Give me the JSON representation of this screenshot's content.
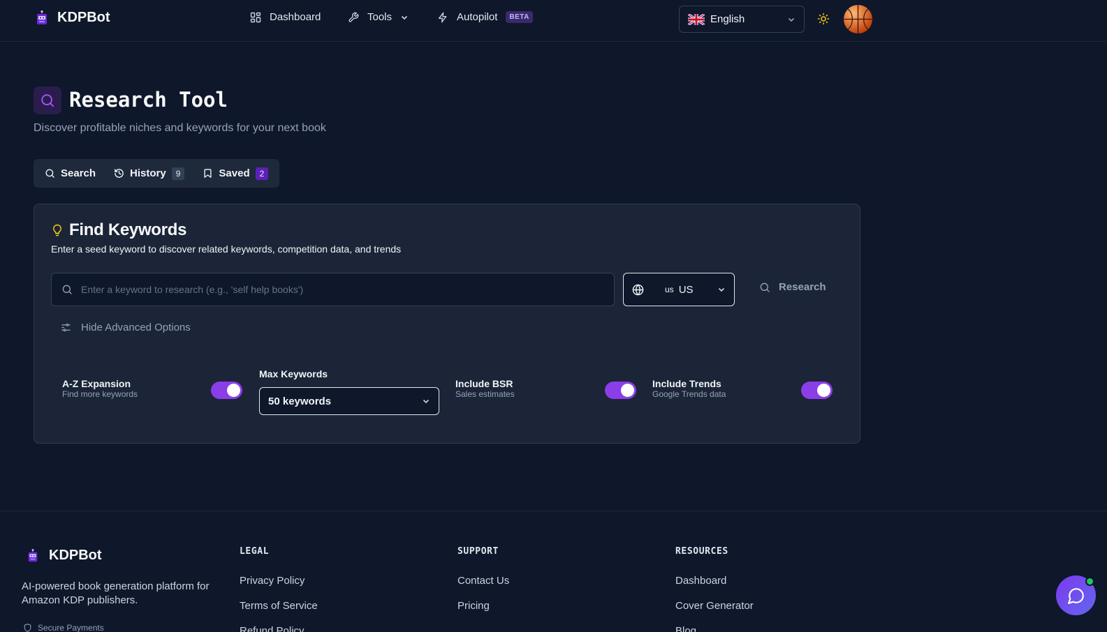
{
  "header": {
    "brand": "KDPBot",
    "nav": {
      "dashboard": "Dashboard",
      "tools": "Tools",
      "autopilot": "Autopilot",
      "autopilot_badge": "BETA"
    },
    "language": {
      "selected": "English",
      "flag_icon": "uk-flag-icon"
    },
    "theme_icon": "sun-icon",
    "avatar_icon": "basketball-avatar"
  },
  "page": {
    "title": "Research Tool",
    "subtitle": "Discover profitable niches and keywords for your next book"
  },
  "tabs": [
    {
      "label": "Search",
      "icon": "search-icon"
    },
    {
      "label": "History",
      "icon": "history-icon",
      "count": "9"
    },
    {
      "label": "Saved",
      "icon": "bookmark-icon",
      "count": "2"
    }
  ],
  "card": {
    "title": "Find Keywords",
    "description": "Enter a seed keyword to discover related keywords, competition data, and trends",
    "keyword_input": {
      "value": "",
      "placeholder": "Enter a keyword to research (e.g., 'self help books')"
    },
    "country": {
      "code_small": "us",
      "code": "US"
    },
    "research_button": "Research",
    "advanced_toggle": "Hide Advanced Options",
    "options": {
      "az_expansion": {
        "label": "A-Z Expansion",
        "sub": "Find more keywords",
        "on": true
      },
      "max_keywords": {
        "label": "Max Keywords",
        "value": "50 keywords"
      },
      "include_bsr": {
        "label": "Include BSR",
        "sub": "Sales estimates",
        "on": true
      },
      "include_trends": {
        "label": "Include Trends",
        "sub": "Google Trends data",
        "on": true
      }
    }
  },
  "footer": {
    "brand": "KDPBot",
    "description": "AI-powered book generation platform for Amazon KDP publishers.",
    "secure": "Secure Payments",
    "legal": {
      "heading": "LEGAL",
      "links": [
        "Privacy Policy",
        "Terms of Service",
        "Refund Policy"
      ]
    },
    "support": {
      "heading": "SUPPORT",
      "links": [
        "Contact Us",
        "Pricing"
      ]
    },
    "resources": {
      "heading": "RESOURCES",
      "links": [
        "Dashboard",
        "Cover Generator",
        "Blog"
      ]
    }
  },
  "colors": {
    "background": "#0f172a",
    "card": "#1b2537",
    "accent": "#8b3ee8",
    "muted_text": "#94a3b8"
  }
}
